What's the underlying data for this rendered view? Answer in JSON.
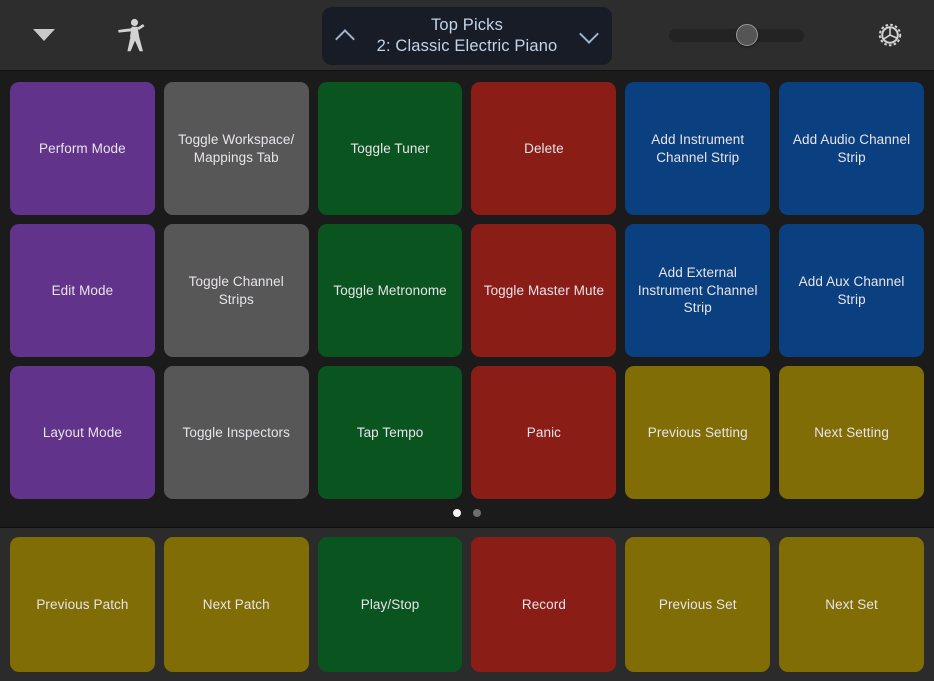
{
  "header": {
    "menu_icon": "triangle-down-icon",
    "performer_icon": "performer-icon",
    "settings_icon": "gear-icon",
    "prev_patch_chevron": "chevron-up-icon",
    "next_patch_chevron": "chevron-down-icon",
    "patch": {
      "set_name": "Top Picks",
      "patch_name": "2: Classic Electric Piano"
    },
    "slider": {
      "name": "master-volume-slider",
      "value_percent": 58
    }
  },
  "colors": {
    "purple": "#61338a",
    "grey": "#575757",
    "green": "#0a5420",
    "red": "#8b1d17",
    "blue": "#0b4080",
    "olive": "#806d06",
    "background": "#1b1b1b",
    "header_background": "#2d2d2d",
    "bottom_background": "#2b2b2b",
    "patch_background": "#171c26",
    "text": "#e8e4ea"
  },
  "grid": {
    "rows": 3,
    "columns": 6,
    "pads": [
      {
        "label": "Perform Mode",
        "color": "#61338a"
      },
      {
        "label": "Toggle Workspace/ Mappings Tab",
        "color": "#575757"
      },
      {
        "label": "Toggle Tuner",
        "color": "#0a5420"
      },
      {
        "label": "Delete",
        "color": "#8b1d17"
      },
      {
        "label": "Add Instrument Channel Strip",
        "color": "#0b4080"
      },
      {
        "label": "Add Audio Channel Strip",
        "color": "#0b4080"
      },
      {
        "label": "Edit Mode",
        "color": "#61338a"
      },
      {
        "label": "Toggle Channel Strips",
        "color": "#575757"
      },
      {
        "label": "Toggle Metronome",
        "color": "#0a5420"
      },
      {
        "label": "Toggle Master Mute",
        "color": "#8b1d17"
      },
      {
        "label": "Add External Instrument Channel Strip",
        "color": "#0b4080"
      },
      {
        "label": "Add Aux Channel Strip",
        "color": "#0b4080"
      },
      {
        "label": "Layout Mode",
        "color": "#61338a"
      },
      {
        "label": "Toggle Inspectors",
        "color": "#575757"
      },
      {
        "label": "Tap Tempo",
        "color": "#0a5420"
      },
      {
        "label": "Panic",
        "color": "#8b1d17"
      },
      {
        "label": "Previous Setting",
        "color": "#806d06"
      },
      {
        "label": "Next Setting",
        "color": "#806d06"
      }
    ]
  },
  "pager": {
    "total_pages": 2,
    "active_page": 1
  },
  "bottom_bar": {
    "pads": [
      {
        "label": "Previous Patch",
        "color": "#806d06"
      },
      {
        "label": "Next Patch",
        "color": "#806d06"
      },
      {
        "label": "Play/Stop",
        "color": "#0a5420"
      },
      {
        "label": "Record",
        "color": "#8b1d17"
      },
      {
        "label": "Previous Set",
        "color": "#806d06"
      },
      {
        "label": "Next Set",
        "color": "#806d06"
      }
    ]
  }
}
